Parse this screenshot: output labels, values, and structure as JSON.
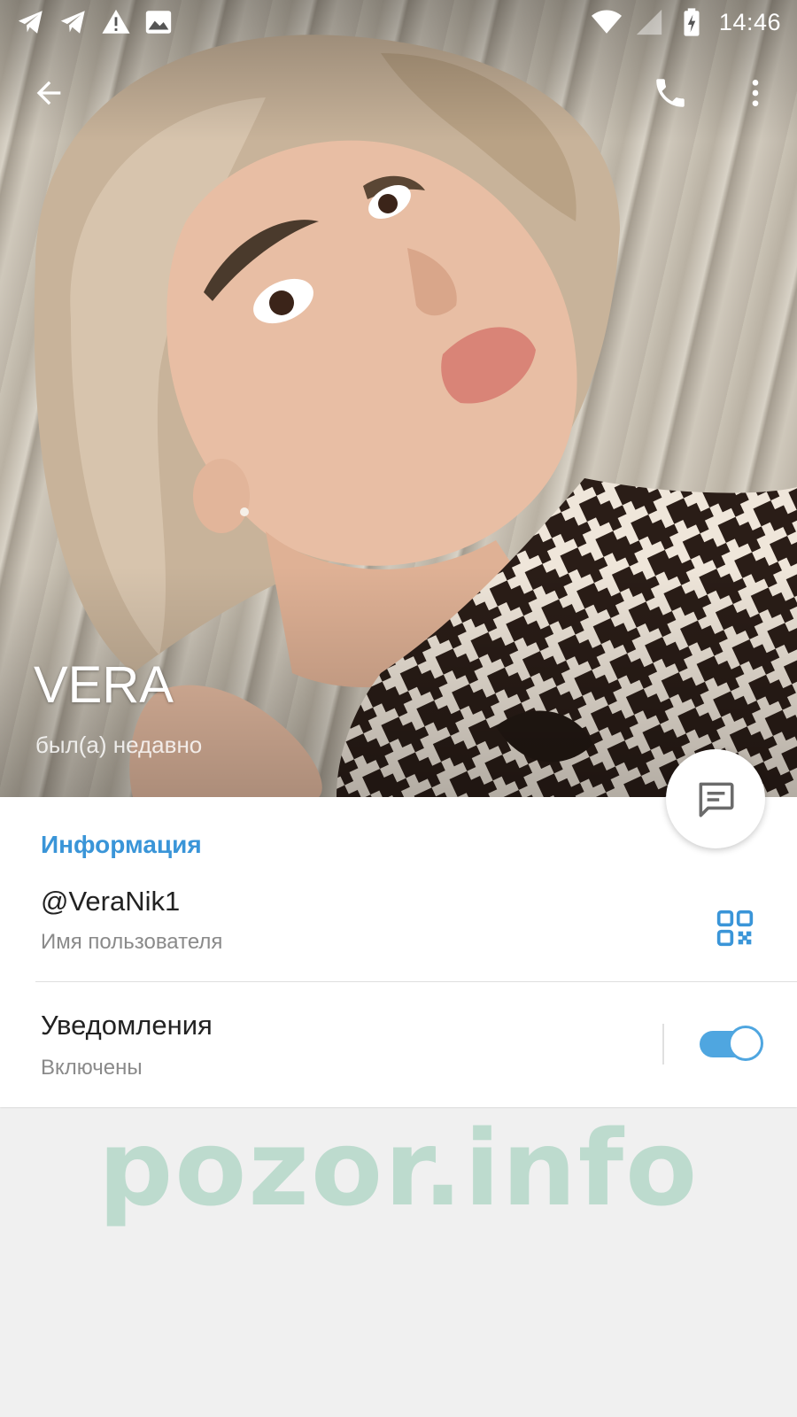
{
  "status_bar": {
    "time": "14:46",
    "left_icons": [
      "telegram-icon",
      "telegram-icon",
      "warning-icon",
      "image-icon"
    ],
    "right_icons": [
      "wifi-icon",
      "signal-icon",
      "battery-charging-icon"
    ]
  },
  "toolbar": {
    "back_icon": "arrow-back-icon",
    "call_icon": "phone-icon",
    "more_icon": "more-vertical-icon"
  },
  "profile": {
    "name": "VERA",
    "last_seen": "был(а) недавно"
  },
  "fab": {
    "icon": "message-icon"
  },
  "info": {
    "section_title": "Информация",
    "username": "@VeraNik1",
    "username_label": "Имя пользователя",
    "qr_icon": "qr-code-icon"
  },
  "notifications": {
    "title": "Уведомления",
    "status": "Включены",
    "enabled": true
  },
  "watermark": "pozor.info",
  "colors": {
    "accent": "#3a95d8",
    "toggle": "#4fa6e0",
    "watermark": "#78bea0"
  }
}
